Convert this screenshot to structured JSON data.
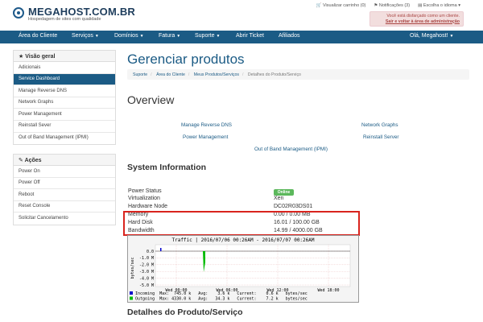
{
  "header": {
    "logo_text": "MEGAHOST.COM.BR",
    "logo_tagline": "Hospedagem de sites com qualidade",
    "cart_link": "Visualizar carrinho (0)",
    "notifications_link": "Notificações (3)",
    "language_link": "Escolha o idioma",
    "admin_notice": "Você está disfarçado como um cliente.",
    "admin_return_link": "Sair e voltar à área de administração"
  },
  "nav": {
    "items": [
      "Área do Cliente",
      "Serviços",
      "Domínios",
      "Fatura",
      "Suporte",
      "Abrir Ticket",
      "Afiliados"
    ],
    "user_menu": "Olá, Megahost!"
  },
  "sidebar": {
    "overview_title": "Visão geral",
    "overview_items": [
      "Adicionais",
      "Service Dashboard",
      "Manage Reverse DNS",
      "Network Graphs",
      "Power Management",
      "Reinstall Sever",
      "Out of Band Management (IPMI)"
    ],
    "actions_title": "Ações",
    "action_items": [
      "Power On",
      "Power Off",
      "Reboot",
      "Reset Console",
      "Solicitar Cancelamento"
    ]
  },
  "main": {
    "page_title": "Gerenciar produtos",
    "breadcrumb": [
      "Suporte",
      "Área do Cliente",
      "Meus Produtos/Serviços",
      "Detalhes do Produto/Serviço"
    ],
    "overview_title": "Overview",
    "overview_links": {
      "reverse_dns": "Manage Reverse DNS",
      "network_graphs": "Network Graphs",
      "power_management": "Power Management",
      "reinstall": "Reinstall Server",
      "ipmi": "Out of Band Management (IPMI)"
    },
    "system_info_title": "System Information",
    "system_info": [
      {
        "label": "Power Status",
        "value": "Online"
      },
      {
        "label": "Virtualization",
        "value": "Xen"
      },
      {
        "label": "Hardware Node",
        "value": "DC02R03DS01"
      },
      {
        "label": "Memory",
        "value": "0.00 / 0.00 MB"
      },
      {
        "label": "Hard Disk",
        "value": "16.01 / 100.00 GB"
      },
      {
        "label": "Bandwidth",
        "value": "14.99 / 4000.00 GB"
      }
    ],
    "details_title": "Detalhes do Produto/Serviço"
  },
  "traffic_graph": {
    "title": "Traffic | 2016/07/06 00:26AM - 2016/07/07 00:26AM",
    "y_axis_label": "bytes/sec",
    "y_ticks": [
      "0.0",
      "-1.0 M",
      "-2.0 M",
      "-3.0 M",
      "-4.0 M",
      "-5.0 M"
    ],
    "x_ticks": [
      "Wed 00:00",
      "Wed 06:00",
      "Wed 12:00",
      "Wed 18:00"
    ],
    "legend": [
      {
        "color": "#0000cc",
        "line": "Incoming  Max:  745.0 k   Avg:    3.6 k   Current:    0.6 k   bytes/sec"
      },
      {
        "color": "#00bb00",
        "line": "Outgoing  Max: 4330.0 k   Avg:   34.3 k   Current:    7.2 k   bytes/sec"
      }
    ]
  },
  "colors": {
    "brand": "#1b5b85",
    "online_badge": "#5cb85c",
    "highlight": "#d9241e"
  }
}
